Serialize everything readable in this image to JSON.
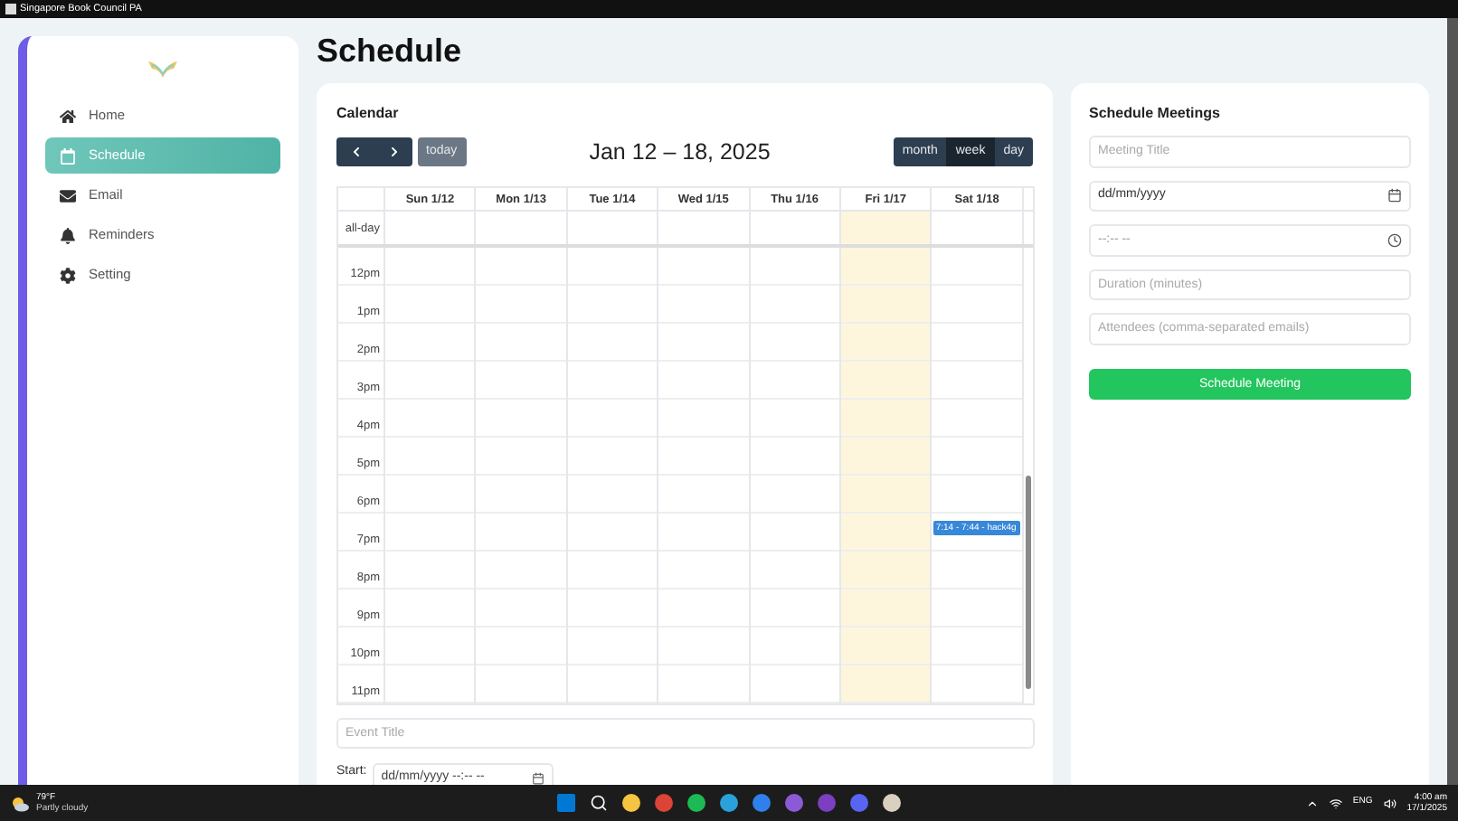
{
  "window": {
    "title": "Singapore Book Council PA"
  },
  "sidebar": {
    "items": [
      {
        "label": "Home",
        "selected": false
      },
      {
        "label": "Schedule",
        "selected": true
      },
      {
        "label": "Email",
        "selected": false
      },
      {
        "label": "Reminders",
        "selected": false
      },
      {
        "label": "Setting",
        "selected": false
      }
    ]
  },
  "page_title": "Schedule",
  "calendar": {
    "heading": "Calendar",
    "today_button": "today",
    "range": "Jan 12 – 18, 2025",
    "views": [
      {
        "label": "month",
        "selected": false
      },
      {
        "label": "week",
        "selected": true
      },
      {
        "label": "day",
        "selected": false
      }
    ],
    "all_day_label": "all-day",
    "columns": [
      {
        "label": "Sun 1/12",
        "today": false
      },
      {
        "label": "Mon 1/13",
        "today": false
      },
      {
        "label": "Tue 1/14",
        "today": false
      },
      {
        "label": "Wed 1/15",
        "today": false
      },
      {
        "label": "Thu 1/16",
        "today": false
      },
      {
        "label": "Fri 1/17",
        "today": true
      },
      {
        "label": "Sat 1/18",
        "today": false
      }
    ],
    "hours": [
      {
        "label": "12pm",
        "cells": [
          {
            "today": false
          },
          {
            "today": false
          },
          {
            "today": false
          },
          {
            "today": false
          },
          {
            "today": false
          },
          {
            "today": true
          },
          {
            "today": false
          }
        ]
      },
      {
        "label": "1pm",
        "cells": [
          {
            "today": false
          },
          {
            "today": false
          },
          {
            "today": false
          },
          {
            "today": false
          },
          {
            "today": false
          },
          {
            "today": true
          },
          {
            "today": false
          }
        ]
      },
      {
        "label": "2pm",
        "cells": [
          {
            "today": false
          },
          {
            "today": false
          },
          {
            "today": false
          },
          {
            "today": false
          },
          {
            "today": false
          },
          {
            "today": true
          },
          {
            "today": false
          }
        ]
      },
      {
        "label": "3pm",
        "cells": [
          {
            "today": false
          },
          {
            "today": false
          },
          {
            "today": false
          },
          {
            "today": false
          },
          {
            "today": false
          },
          {
            "today": true
          },
          {
            "today": false
          }
        ]
      },
      {
        "label": "4pm",
        "cells": [
          {
            "today": false
          },
          {
            "today": false
          },
          {
            "today": false
          },
          {
            "today": false
          },
          {
            "today": false
          },
          {
            "today": true
          },
          {
            "today": false
          }
        ]
      },
      {
        "label": "5pm",
        "cells": [
          {
            "today": false
          },
          {
            "today": false
          },
          {
            "today": false
          },
          {
            "today": false
          },
          {
            "today": false
          },
          {
            "today": true
          },
          {
            "today": false
          }
        ]
      },
      {
        "label": "6pm",
        "cells": [
          {
            "today": false
          },
          {
            "today": false
          },
          {
            "today": false
          },
          {
            "today": false
          },
          {
            "today": false
          },
          {
            "today": true
          },
          {
            "today": false
          }
        ]
      },
      {
        "label": "7pm",
        "cells": [
          {
            "today": false
          },
          {
            "today": false
          },
          {
            "today": false
          },
          {
            "today": false
          },
          {
            "today": false
          },
          {
            "today": true
          },
          {
            "today": false,
            "events": [
              {
                "text": "7:14 - 7:44 - hack4g"
              }
            ]
          }
        ]
      },
      {
        "label": "8pm",
        "cells": [
          {
            "today": false
          },
          {
            "today": false
          },
          {
            "today": false
          },
          {
            "today": false
          },
          {
            "today": false
          },
          {
            "today": true
          },
          {
            "today": false
          }
        ]
      },
      {
        "label": "9pm",
        "cells": [
          {
            "today": false
          },
          {
            "today": false
          },
          {
            "today": false
          },
          {
            "today": false
          },
          {
            "today": false
          },
          {
            "today": true
          },
          {
            "today": false
          }
        ]
      },
      {
        "label": "10pm",
        "cells": [
          {
            "today": false
          },
          {
            "today": false
          },
          {
            "today": false
          },
          {
            "today": false
          },
          {
            "today": false
          },
          {
            "today": true
          },
          {
            "today": false
          }
        ]
      },
      {
        "label": "11pm",
        "cells": [
          {
            "today": false
          },
          {
            "today": false
          },
          {
            "today": false
          },
          {
            "today": false
          },
          {
            "today": false
          },
          {
            "today": true
          },
          {
            "today": false
          }
        ]
      }
    ],
    "event_title": {
      "placeholder": "Event Title"
    },
    "start": {
      "label": "Start:",
      "value": "dd/mm/yyyy --:-- --"
    }
  },
  "meetings": {
    "heading": "Schedule Meetings",
    "fields": [
      {
        "kind": "text",
        "placeholder": "Meeting Title"
      },
      {
        "kind": "date",
        "value": "dd/mm/yyyy"
      },
      {
        "kind": "time",
        "placeholder": "--:-- --"
      },
      {
        "kind": "text",
        "placeholder": "Duration (minutes)"
      },
      {
        "kind": "text",
        "placeholder": "Attendees (comma-separated emails)"
      }
    ],
    "button": "Schedule Meeting"
  },
  "taskbar": {
    "temperature": "79°F",
    "weather": "Partly cloudy",
    "language": "ENG",
    "time": "4:00 am",
    "date": "17/1/2025"
  }
}
